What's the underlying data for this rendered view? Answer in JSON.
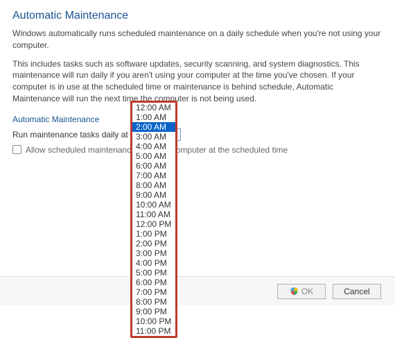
{
  "title": "Automatic Maintenance",
  "desc1": "Windows automatically runs scheduled maintenance on a daily schedule when you're not using your computer.",
  "desc2": "This includes tasks such as software updates, security scanning, and system diagnostics. This maintenance will run daily if you aren't using your computer at the time you've chosen. If your computer is in use at the scheduled time or maintenance is behind schedule, Automatic Maintenance will run the next time the computer is not being used.",
  "section_label": "Automatic Maintenance",
  "run_label": "Run maintenance tasks daily at",
  "combo_value": "2:00 AM",
  "wake_label_before": "Allow scheduled maintenance",
  "wake_label_after": "computer at the scheduled time",
  "dropdown": {
    "selected": "2:00 AM",
    "options": [
      "12:00 AM",
      "1:00 AM",
      "2:00 AM",
      "3:00 AM",
      "4:00 AM",
      "5:00 AM",
      "6:00 AM",
      "7:00 AM",
      "8:00 AM",
      "9:00 AM",
      "10:00 AM",
      "11:00 AM",
      "12:00 PM",
      "1:00 PM",
      "2:00 PM",
      "3:00 PM",
      "4:00 PM",
      "5:00 PM",
      "6:00 PM",
      "7:00 PM",
      "8:00 PM",
      "9:00 PM",
      "10:00 PM",
      "11:00 PM"
    ]
  },
  "buttons": {
    "ok": "OK",
    "cancel": "Cancel"
  }
}
